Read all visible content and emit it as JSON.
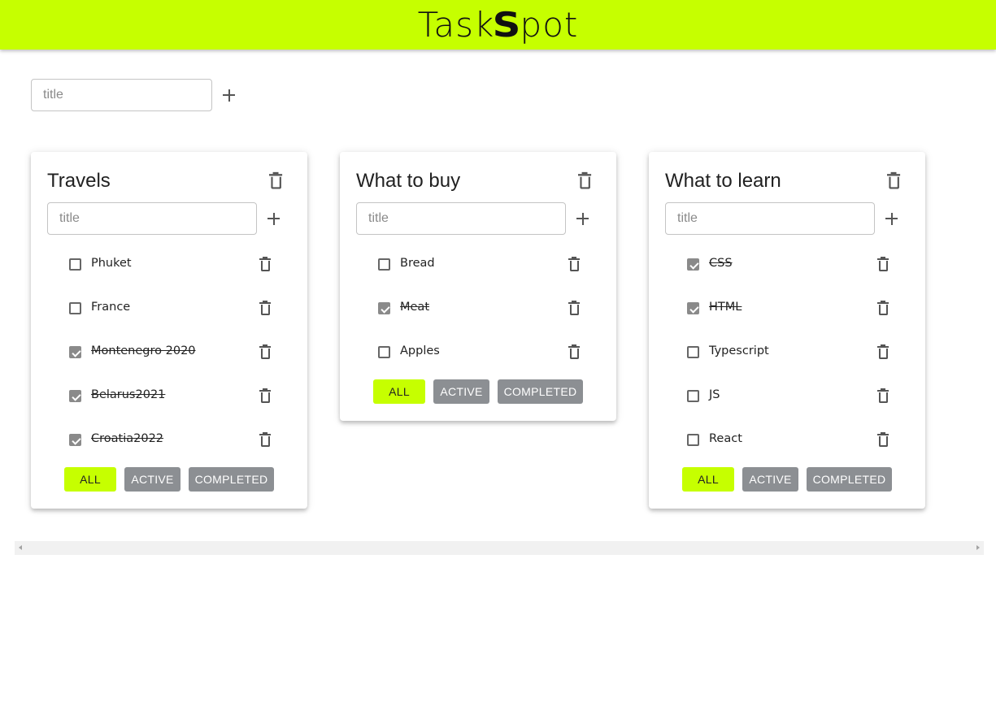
{
  "app": {
    "logo_left": "Task",
    "logo_s": "S",
    "logo_right": "pot",
    "accent_color": "#c6ff00",
    "button_grey": "#8c8f93"
  },
  "new_list": {
    "placeholder": "title",
    "value": "",
    "add_icon": "plus-icon"
  },
  "lists": [
    {
      "title": "Travels",
      "input_placeholder": "title",
      "tasks": [
        {
          "label": "Phuket",
          "done": false
        },
        {
          "label": "France",
          "done": false
        },
        {
          "label": "Montenegro 2020",
          "done": true
        },
        {
          "label": "Belarus2021",
          "done": true
        },
        {
          "label": "Croatia2022",
          "done": true
        }
      ],
      "filters": {
        "all": "ALL",
        "active": "ACTIVE",
        "completed": "COMPLETED",
        "selected": "all"
      }
    },
    {
      "title": "What to buy",
      "input_placeholder": "title",
      "tasks": [
        {
          "label": "Bread",
          "done": false
        },
        {
          "label": "Meat",
          "done": true
        },
        {
          "label": "Apples",
          "done": false
        }
      ],
      "filters": {
        "all": "ALL",
        "active": "ACTIVE",
        "completed": "COMPLETED",
        "selected": "all"
      }
    },
    {
      "title": "What to learn",
      "input_placeholder": "title",
      "tasks": [
        {
          "label": "CSS",
          "done": true
        },
        {
          "label": "HTML",
          "done": true
        },
        {
          "label": "Typescript",
          "done": false
        },
        {
          "label": "JS",
          "done": false
        },
        {
          "label": "React",
          "done": false
        }
      ],
      "filters": {
        "all": "ALL",
        "active": "ACTIVE",
        "completed": "COMPLETED",
        "selected": "all"
      }
    }
  ]
}
